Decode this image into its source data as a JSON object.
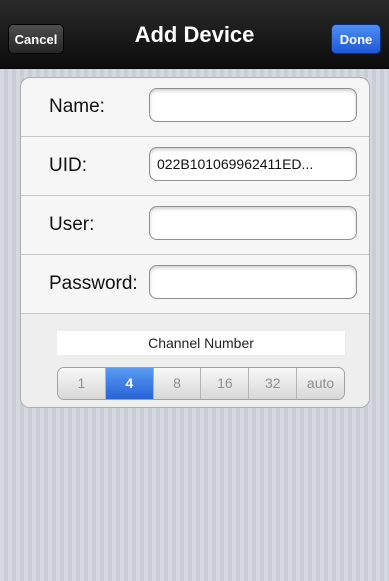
{
  "nav": {
    "cancel_label": "Cancel",
    "title": "Add Device",
    "done_label": "Done"
  },
  "form": {
    "name": {
      "label": "Name:",
      "value": ""
    },
    "uid": {
      "label": "UID:",
      "value": "022B101069962411ED..."
    },
    "user": {
      "label": "User:",
      "value": ""
    },
    "password": {
      "label": "Password:",
      "value": ""
    }
  },
  "channel": {
    "label": "Channel Number",
    "options": [
      "1",
      "4",
      "8",
      "16",
      "32",
      "auto"
    ],
    "selected": "4"
  },
  "colors": {
    "nav_background": "#0c0c0c",
    "done_button": "#1f58d8",
    "segment_selected": "#2763d6",
    "page_background": "#c9ced6"
  }
}
